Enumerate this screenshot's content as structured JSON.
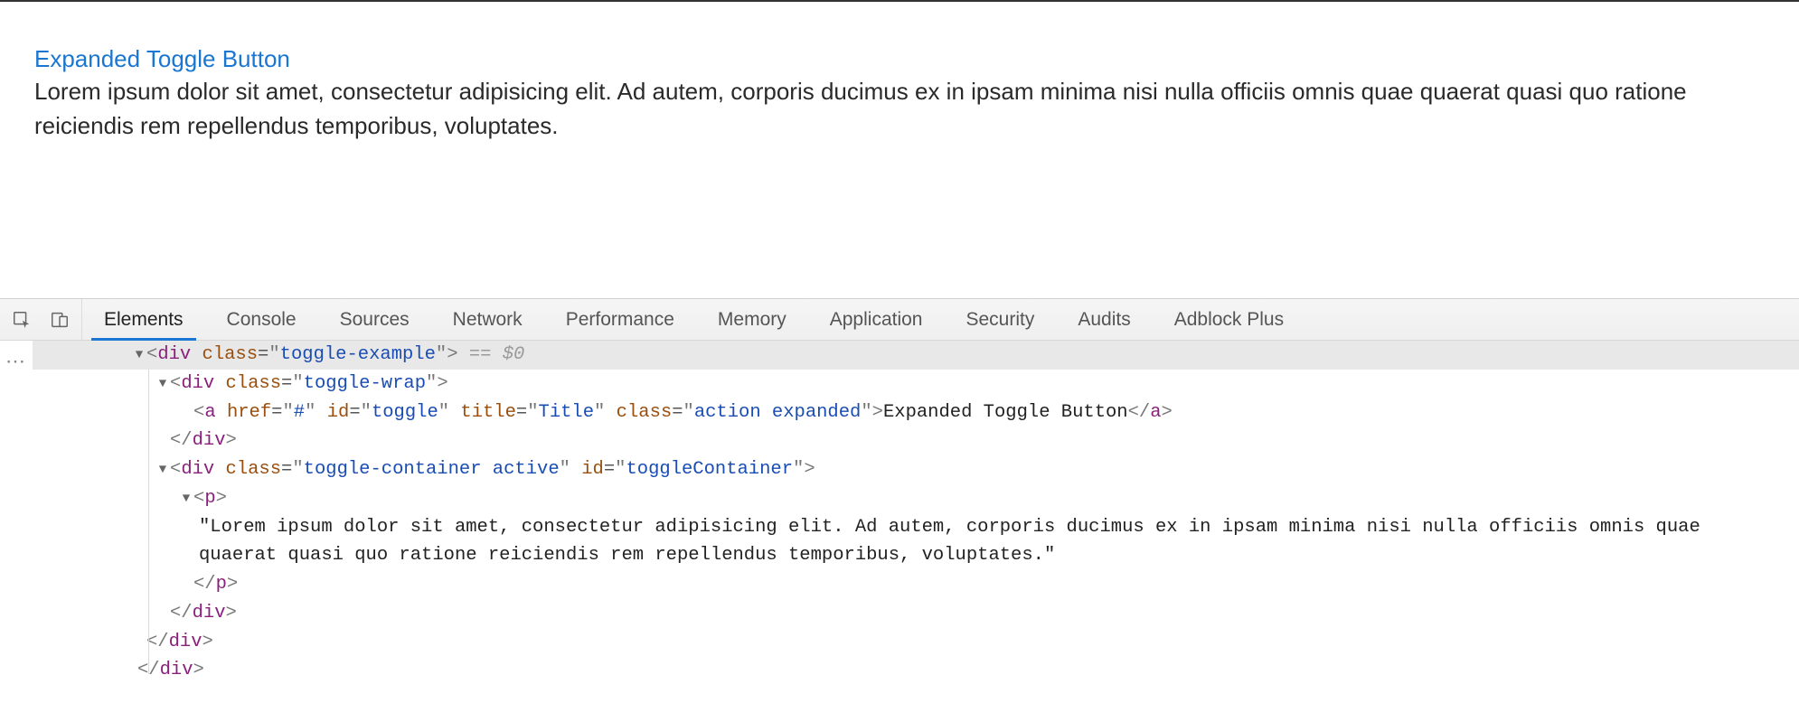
{
  "page": {
    "toggle_label": "Expanded Toggle Button",
    "toggle_href": "#",
    "paragraph": "Lorem ipsum dolor sit amet, consectetur adipisicing elit. Ad autem, corporis ducimus ex in ipsam minima nisi nulla officiis omnis quae quaerat quasi quo ratione reiciendis rem repellendus temporibus, voluptates."
  },
  "devtools": {
    "tabs": [
      "Elements",
      "Console",
      "Sources",
      "Network",
      "Performance",
      "Memory",
      "Application",
      "Security",
      "Audits",
      "Adblock Plus"
    ],
    "active_tab_index": 0,
    "selected_marker": "== $0",
    "overflow": "⋯"
  },
  "dom": {
    "lines": [
      {
        "indent": 1,
        "disclosure": "▼",
        "open": "div",
        "attrs": [
          [
            "class",
            "toggle-example"
          ]
        ],
        "selected": true,
        "sel0": true
      },
      {
        "indent": 2,
        "disclosure": "▼",
        "open": "div",
        "attrs": [
          [
            "class",
            "toggle-wrap"
          ]
        ]
      },
      {
        "indent": 3,
        "open": "a",
        "attrs": [
          [
            "href",
            "#"
          ],
          [
            "id",
            "toggle"
          ],
          [
            "title",
            "Title"
          ],
          [
            "class",
            "action expanded"
          ]
        ],
        "text": "Expanded Toggle Button",
        "close_inline": "a"
      },
      {
        "indent": 2,
        "close": "div"
      },
      {
        "indent": 2,
        "disclosure": "▼",
        "open": "div",
        "attrs": [
          [
            "class",
            "toggle-container active"
          ],
          [
            "id",
            "toggleContainer"
          ]
        ]
      },
      {
        "indent": 3,
        "disclosure": "▼",
        "open": "p"
      },
      {
        "indent": 5,
        "raw": "\"Lorem ipsum dolor sit amet, consectetur adipisicing elit. Ad autem, corporis ducimus ex in ipsam minima nisi nulla officiis omnis quae quaerat quasi quo ratione reiciendis rem repellendus temporibus, voluptates.\""
      },
      {
        "indent": 3,
        "close": "p"
      },
      {
        "indent": 2,
        "close": "div"
      },
      {
        "indent": 1,
        "close": "div"
      },
      {
        "indent": 0,
        "close": "div",
        "root": true
      }
    ]
  }
}
